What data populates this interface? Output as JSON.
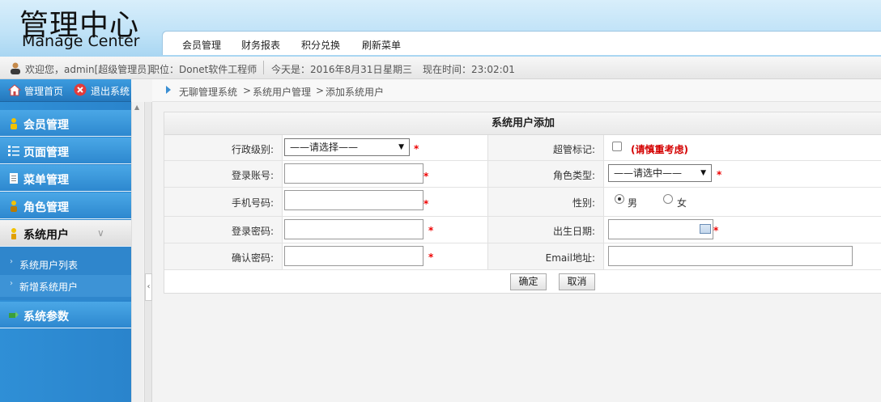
{
  "header": {
    "logo_cn": "管理中心",
    "logo_en": "Manage Center",
    "nav": [
      "会员管理",
      "财务报表",
      "积分兑换",
      "刷新菜单"
    ]
  },
  "infobar": {
    "welcome": "欢迎您，admin[超级管理员]",
    "position": "职位：Donet软件工程师",
    "today": "今天是：2016年8月31日",
    "weekday": "星期三",
    "time": "现在时间：23:02:01"
  },
  "sidebar": {
    "home": "管理首页",
    "logout": "退出系统",
    "menu": [
      "会员管理",
      "页面管理",
      "菜单管理",
      "角色管理",
      "系统用户",
      "系统参数"
    ],
    "submenu": [
      "系统用户列表",
      "新增系统用户"
    ]
  },
  "breadcrumb": [
    "无聊管理系统",
    ">",
    "系统用户管理",
    ">",
    "添加系统用户"
  ],
  "form": {
    "title": "系统用户添加",
    "admin_level_label": "行政级别:",
    "admin_level_value": "——请选择——",
    "super_flag_label": "超管标记:",
    "super_flag_warn": "(请慎重考虑)",
    "account_label": "登录账号:",
    "role_label": "角色类型:",
    "role_value": "——请选中——",
    "phone_label": "手机号码:",
    "gender_label": "性别:",
    "gender_male": "男",
    "gender_female": "女",
    "password_label": "登录密码:",
    "birthday_label": "出生日期:",
    "confirm_label": "确认密码:",
    "email_label": "Email地址:",
    "required": "*",
    "submit": "确定",
    "cancel": "取消"
  },
  "colors": {
    "sidebar_blue": "#2f8fd6",
    "required_red": "#e00000",
    "warn_red": "#d40000"
  }
}
